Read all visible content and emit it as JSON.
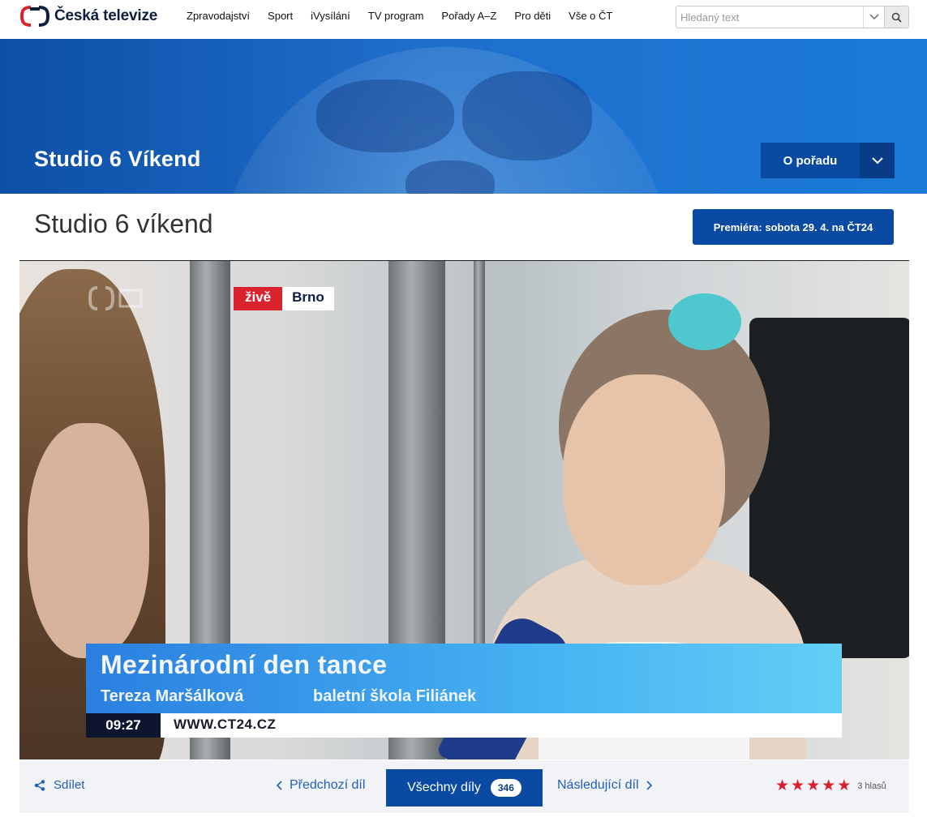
{
  "header": {
    "logo_text": "Česká televize",
    "nav": [
      "Zpravodajství",
      "Sport",
      "iVysílání",
      "TV program",
      "Pořady A–Z",
      "Pro děti",
      "Vše o ČT"
    ],
    "search_placeholder": "Hledaný text"
  },
  "banner": {
    "title": "Studio 6 Víkend",
    "about_button": "O pořadu"
  },
  "page": {
    "title": "Studio 6 víkend",
    "premiere_button": "Premiéra: sobota 29. 4. na ČT24"
  },
  "video": {
    "live_label": "živě",
    "live_city": "Brno",
    "caption_title": "Mezinárodní den tance",
    "caption_name": "Tereza Maršálková",
    "caption_org": "baletní škola Filiánek",
    "time": "09:27",
    "url": "WWW.CT24.CZ"
  },
  "controls": {
    "share": "Sdílet",
    "previous": "Předchozí díl",
    "all_episodes": "Všechny díly",
    "episode_count": "346",
    "next": "Následující díl",
    "rating_stars": 5,
    "votes": "3 hlasů"
  },
  "colors": {
    "brand_blue": "#0a4aa3",
    "live_red": "#d9232e",
    "star_red": "#d8202d",
    "link_blue": "#1f5fb8"
  }
}
